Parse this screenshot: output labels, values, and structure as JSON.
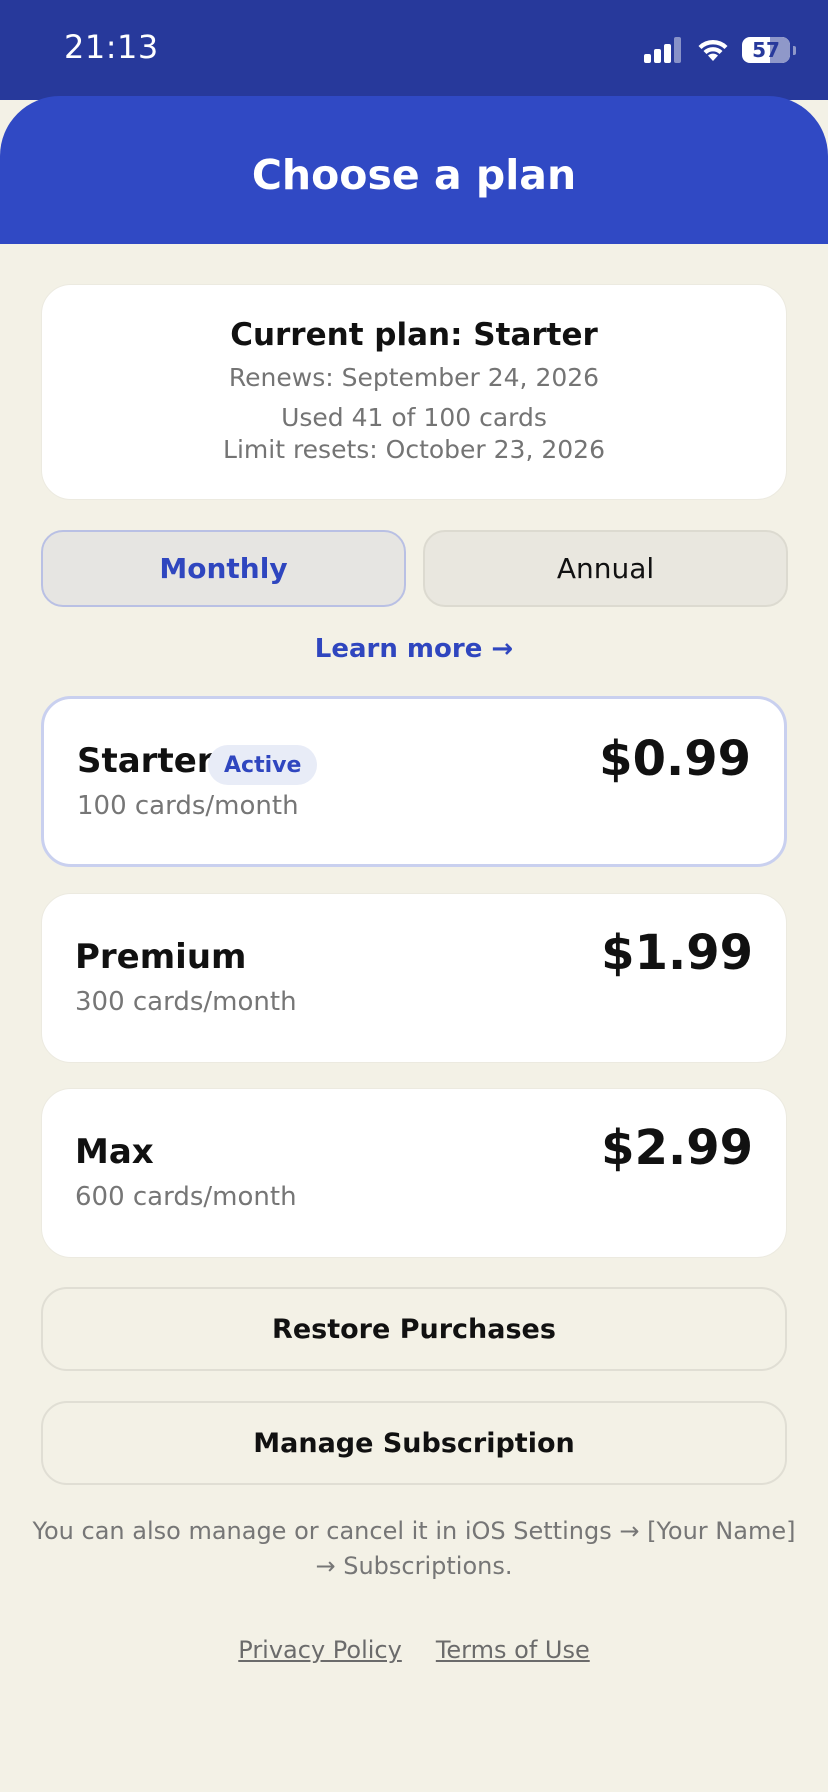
{
  "status_bar": {
    "time": "21:13",
    "battery": "57",
    "icons": [
      "signal-icon",
      "wifi-icon",
      "battery-icon"
    ]
  },
  "header": {
    "title": "Choose a plan"
  },
  "current_plan": {
    "title": "Current plan: Starter",
    "renews": "Renews: September 24, 2026",
    "usage": "Used 41 of 100 cards",
    "resets": "Limit resets: October 23, 2026"
  },
  "billing_toggle": {
    "monthly": "Monthly",
    "annual": "Annual",
    "selected": "Monthly"
  },
  "learn_more": "Learn more →",
  "plans": [
    {
      "name": "Starter",
      "badge": "Active",
      "desc": "100 cards/month",
      "price": "$0.99"
    },
    {
      "name": "Premium",
      "desc": "300 cards/month",
      "price": "$1.99"
    },
    {
      "name": "Max",
      "desc": "600 cards/month",
      "price": "$2.99"
    }
  ],
  "actions": {
    "restore": "Restore Purchases",
    "manage": "Manage Subscription"
  },
  "footnote": "You can also manage or cancel it in iOS Settings → [Your Name] → Subscriptions.",
  "legal": {
    "privacy": "Privacy Policy",
    "terms": "Terms of Use"
  },
  "colors": {
    "status_bar": "#27399b",
    "header": "#3049c4",
    "accent": "#2f46bf",
    "background": "#f3f1e6"
  }
}
